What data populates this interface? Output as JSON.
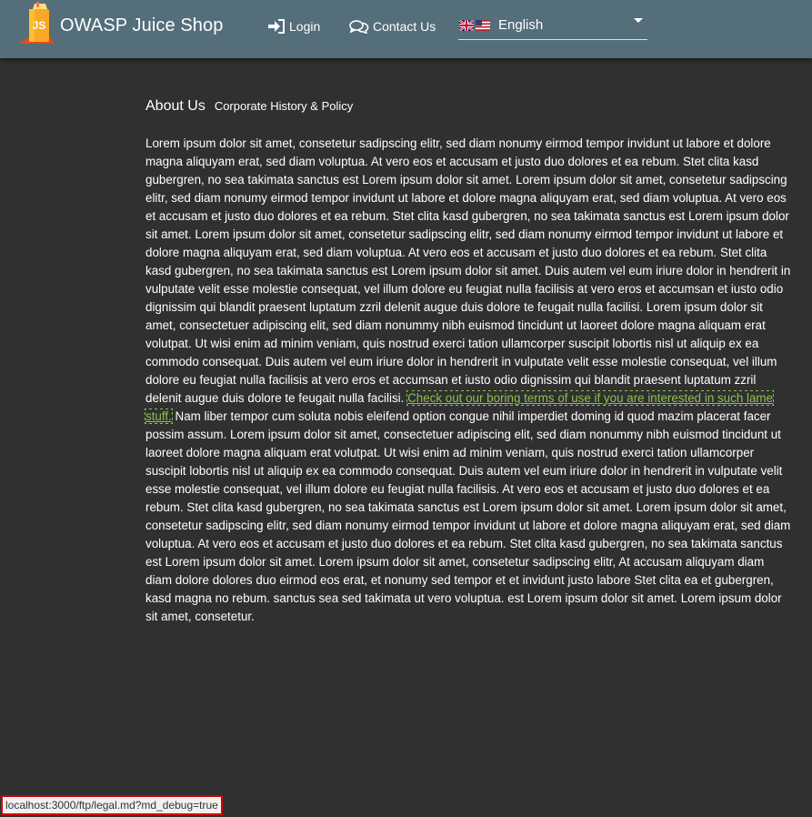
{
  "toolbar": {
    "app_title": "OWASP Juice Shop",
    "logo_icon": "juice-shop-logo-icon",
    "logo_text": "JS",
    "login_label": "Login",
    "login_icon": "sign-in-icon",
    "contact_label": "Contact Us",
    "contact_icon": "comments-icon",
    "language": {
      "selected": "English",
      "flag_icons": [
        "uk-flag-icon",
        "us-flag-icon"
      ],
      "dropdown_icon": "caret-down-icon"
    },
    "colors": {
      "background": "#546e7a",
      "text": "#ffffff"
    }
  },
  "page": {
    "title": "About Us",
    "subtitle": "Corporate History & Policy",
    "paragraph_before": "Lorem ipsum dolor sit amet, consetetur sadipscing elitr, sed diam nonumy eirmod tempor invidunt ut labore et dolore magna aliquyam erat, sed diam voluptua. At vero eos et accusam et justo duo dolores et ea rebum. Stet clita kasd gubergren, no sea takimata sanctus est Lorem ipsum dolor sit amet. Lorem ipsum dolor sit amet, consetetur sadipscing elitr, sed diam nonumy eirmod tempor invidunt ut labore et dolore magna aliquyam erat, sed diam voluptua. At vero eos et accusam et justo duo dolores et ea rebum. Stet clita kasd gubergren, no sea takimata sanctus est Lorem ipsum dolor sit amet. Lorem ipsum dolor sit amet, consetetur sadipscing elitr, sed diam nonumy eirmod tempor invidunt ut labore et dolore magna aliquyam erat, sed diam voluptua. At vero eos et accusam et justo duo dolores et ea rebum. Stet clita kasd gubergren, no sea takimata sanctus est Lorem ipsum dolor sit amet. Duis autem vel eum iriure dolor in hendrerit in vulputate velit esse molestie consequat, vel illum dolore eu feugiat nulla facilisis at vero eros et accumsan et iusto odio dignissim qui blandit praesent luptatum zzril delenit augue duis dolore te feugait nulla facilisi. Lorem ipsum dolor sit amet, consectetuer adipiscing elit, sed diam nonummy nibh euismod tincidunt ut laoreet dolore magna aliquam erat volutpat. Ut wisi enim ad minim veniam, quis nostrud exerci tation ullamcorper suscipit lobortis nisl ut aliquip ex ea commodo consequat. Duis autem vel eum iriure dolor in hendrerit in vulputate velit esse molestie consequat, vel illum dolore eu feugiat nulla facilisis at vero eros et accumsan et iusto odio dignissim qui blandit praesent luptatum zzril delenit augue duis dolore te feugait nulla facilisi. ",
    "link_text": "Check out our boring terms of use if you are interested in such lame stuff.",
    "paragraph_after": " Nam liber tempor cum soluta nobis eleifend option congue nihil imperdiet doming id quod mazim placerat facer possim assum. Lorem ipsum dolor sit amet, consectetuer adipiscing elit, sed diam nonummy nibh euismod tincidunt ut laoreet dolore magna aliquam erat volutpat. Ut wisi enim ad minim veniam, quis nostrud exerci tation ullamcorper suscipit lobortis nisl ut aliquip ex ea commodo consequat. Duis autem vel eum iriure dolor in hendrerit in vulputate velit esse molestie consequat, vel illum dolore eu feugiat nulla facilisis. At vero eos et accusam et justo duo dolores et ea rebum. Stet clita kasd gubergren, no sea takimata sanctus est Lorem ipsum dolor sit amet. Lorem ipsum dolor sit amet, consetetur sadipscing elitr, sed diam nonumy eirmod tempor invidunt ut labore et dolore magna aliquyam erat, sed diam voluptua. At vero eos et accusam et justo duo dolores et ea rebum. Stet clita kasd gubergren, no sea takimata sanctus est Lorem ipsum dolor sit amet. Lorem ipsum dolor sit amet, consetetur sadipscing elitr, At accusam aliquyam diam diam dolore dolores duo eirmod eos erat, et nonumy sed tempor et et invidunt justo labore Stet clita ea et gubergren, kasd magna no rebum. sanctus sea sed takimata ut vero voluptua. est Lorem ipsum dolor sit amet. Lorem ipsum dolor sit amet, consetetur.",
    "colors": {
      "background": "#303030",
      "link": "#8bc34a"
    }
  },
  "status_bar": {
    "url": "localhost:3000/ftp/legal.md?md_debug=true",
    "colors": {
      "border": "#d60000"
    }
  }
}
